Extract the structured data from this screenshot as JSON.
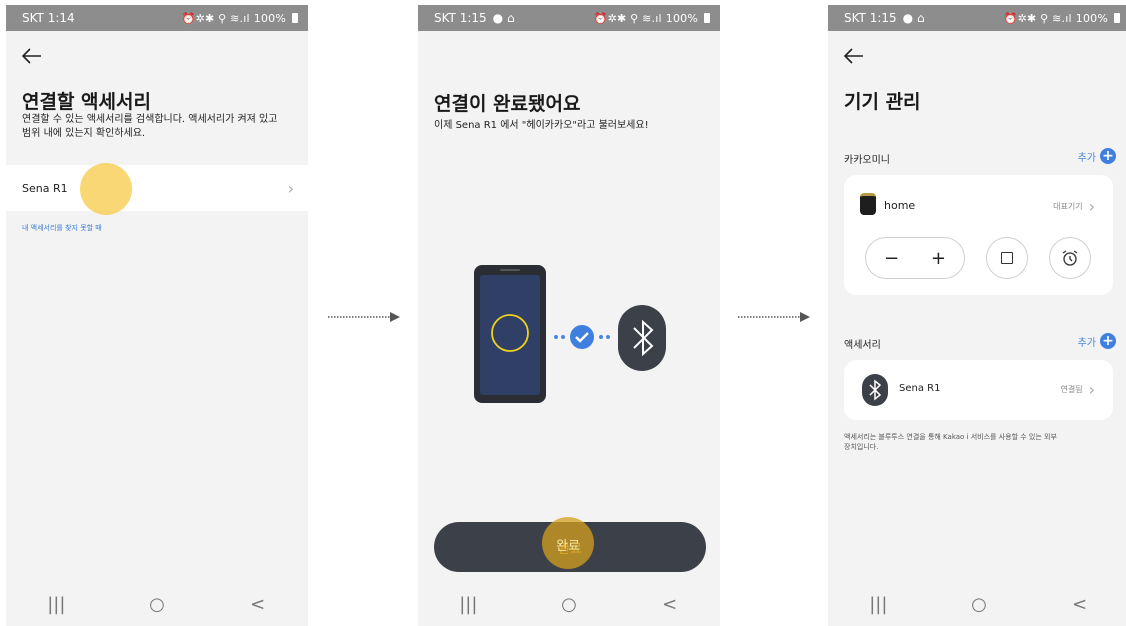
{
  "status": [
    {
      "time": "SKT 1:14",
      "extra": "",
      "right": "100%"
    },
    {
      "time": "SKT 1:15",
      "extra": "● ⌂",
      "right": "100%"
    },
    {
      "time": "SKT 1:15",
      "extra": "● ⌂",
      "right": "100%"
    }
  ],
  "status_icons": "⏰✲✱ ⚲ ≋.ıl",
  "screen1": {
    "title": "연결할 액세서리",
    "subtitle_line1": "연결할 수 있는 액세서리를 검색합니다. 액세서리가 켜져 있고",
    "subtitle_line2": "범위 내에 있는지 확인하세요.",
    "device_name": "Sena R1",
    "help_link": "내 액세서리를 찾지 못할 때"
  },
  "screen2": {
    "title": "연결이 완료됐어요",
    "subtitle": "이제 Sena R1 에서 \"헤이카카오\"라고 불러보세요!",
    "done_button": "완료"
  },
  "screen3": {
    "title": "기기 관리",
    "section_kakaomini": "카카오미니",
    "add_label": "추가",
    "speaker_name": "home",
    "speaker_badge": "대표기기",
    "section_accessory": "액세서리",
    "accessory_name": "Sena R1",
    "accessory_status": "연결됨",
    "footnote_line1": "액세서리는 블루투스 연결을 통해 Kakao i 서비스를 사용할 수 있는 외부",
    "footnote_line2": "장치입니다."
  },
  "nav": {
    "recent": "|||",
    "home": "○",
    "back": "<"
  },
  "colors": {
    "accent_blue": "#3f7fe0",
    "tap_yellow": "#f6c740",
    "dark_button": "#3c4049"
  }
}
